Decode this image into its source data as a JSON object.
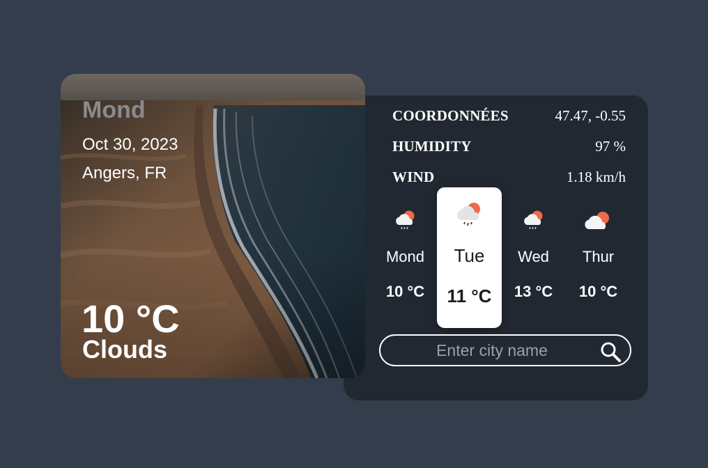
{
  "hero": {
    "day": "Mond",
    "date": "Oct 30, 2023",
    "location": "Angers, FR",
    "temperature": "10 °C",
    "description": "Clouds"
  },
  "details": {
    "coordinates_label": "COORDONNÉES",
    "coordinates_value": "47.47, -0.55",
    "humidity_label": "HUMIDITY",
    "humidity_value": "97 %",
    "wind_label": "WIND",
    "wind_value": "1.18 km/h"
  },
  "forecast": [
    {
      "day": "Mond",
      "temp": "10 °C",
      "icon": "sun-cloud-rain-icon",
      "active": false
    },
    {
      "day": "Tue",
      "temp": "11 °C",
      "icon": "sun-cloud-rain-icon",
      "active": true
    },
    {
      "day": "Wed",
      "temp": "13 °C",
      "icon": "sun-cloud-rain-icon",
      "active": false
    },
    {
      "day": "Thur",
      "temp": "10 °C",
      "icon": "sun-cloud-icon",
      "active": false
    }
  ],
  "search": {
    "placeholder": "Enter city name",
    "icon": "search-icon"
  },
  "colors": {
    "page_background": "#343d4c",
    "panel_background": "#222831",
    "active_card": "#ffffff",
    "sun": "#ee6a4a"
  }
}
